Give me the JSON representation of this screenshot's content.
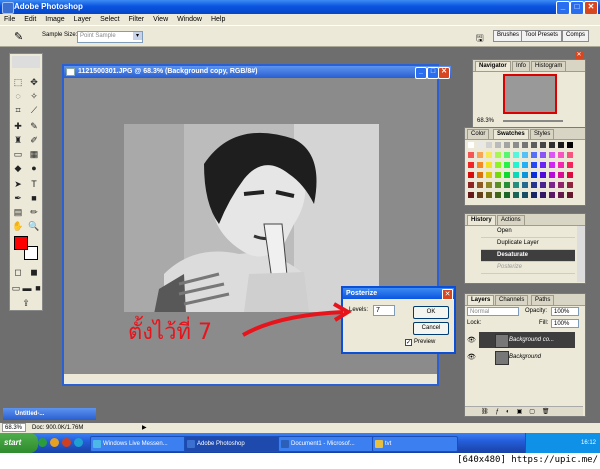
{
  "window": {
    "title": "Adobe Photoshop"
  },
  "menu": [
    "File",
    "Edit",
    "Image",
    "Layer",
    "Select",
    "Filter",
    "View",
    "Window",
    "Help"
  ],
  "options": {
    "sample_label": "Sample Size:",
    "sample_value": "Point Sample"
  },
  "palette_well": [
    "Brushes",
    "Tool Presets",
    "Comps"
  ],
  "document": {
    "title": "1121500301.JPG @ 68.3% (Background copy, RGB/8#)"
  },
  "navigator": {
    "tabs": [
      "Navigator",
      "Info",
      "Histogram"
    ],
    "zoom": "68.3%"
  },
  "swatches": {
    "tabs": [
      "Color",
      "Swatches",
      "Styles"
    ]
  },
  "history": {
    "tabs": [
      "History",
      "Actions"
    ],
    "items": [
      {
        "label": "Open",
        "state": "normal"
      },
      {
        "label": "Duplicate Layer",
        "state": "normal"
      },
      {
        "label": "Desaturate",
        "state": "selected"
      },
      {
        "label": "Posterize",
        "state": "dim"
      }
    ]
  },
  "layers": {
    "tabs": [
      "Layers",
      "Channels",
      "Paths"
    ],
    "blend": "Normal",
    "opacity_label": "Opacity:",
    "opacity": "100%",
    "lock_label": "Lock:",
    "fill_label": "Fill:",
    "fill": "100%",
    "items": [
      {
        "name": "Background co...",
        "selected": true
      },
      {
        "name": "Background",
        "selected": false
      }
    ]
  },
  "posterize": {
    "title": "Posterize",
    "levels_label": "Levels:",
    "levels_value": "7",
    "ok": "OK",
    "cancel": "Cancel",
    "preview": "Preview"
  },
  "annotation": "ตั้งไว้ที่ 7",
  "minimized": {
    "title": "Untitled-..."
  },
  "status": {
    "zoom": "68.3%",
    "doc": "Doc: 900.0K/1.76M"
  },
  "taskbar": {
    "start": "start",
    "items": [
      {
        "label": "Windows Live Messen...",
        "active": false
      },
      {
        "label": "Adobe Photoshop",
        "active": true
      },
      {
        "label": "Document1 - Microsof...",
        "active": false
      },
      {
        "label": "tvt",
        "active": false
      }
    ],
    "clock": "16:12"
  },
  "watermark": "[640x480] https://upic.me/",
  "colors": {
    "foreground": "#ff0000",
    "background": "#ffffff",
    "annotation": "#e8141c",
    "titlebar": "#0a54e0"
  }
}
